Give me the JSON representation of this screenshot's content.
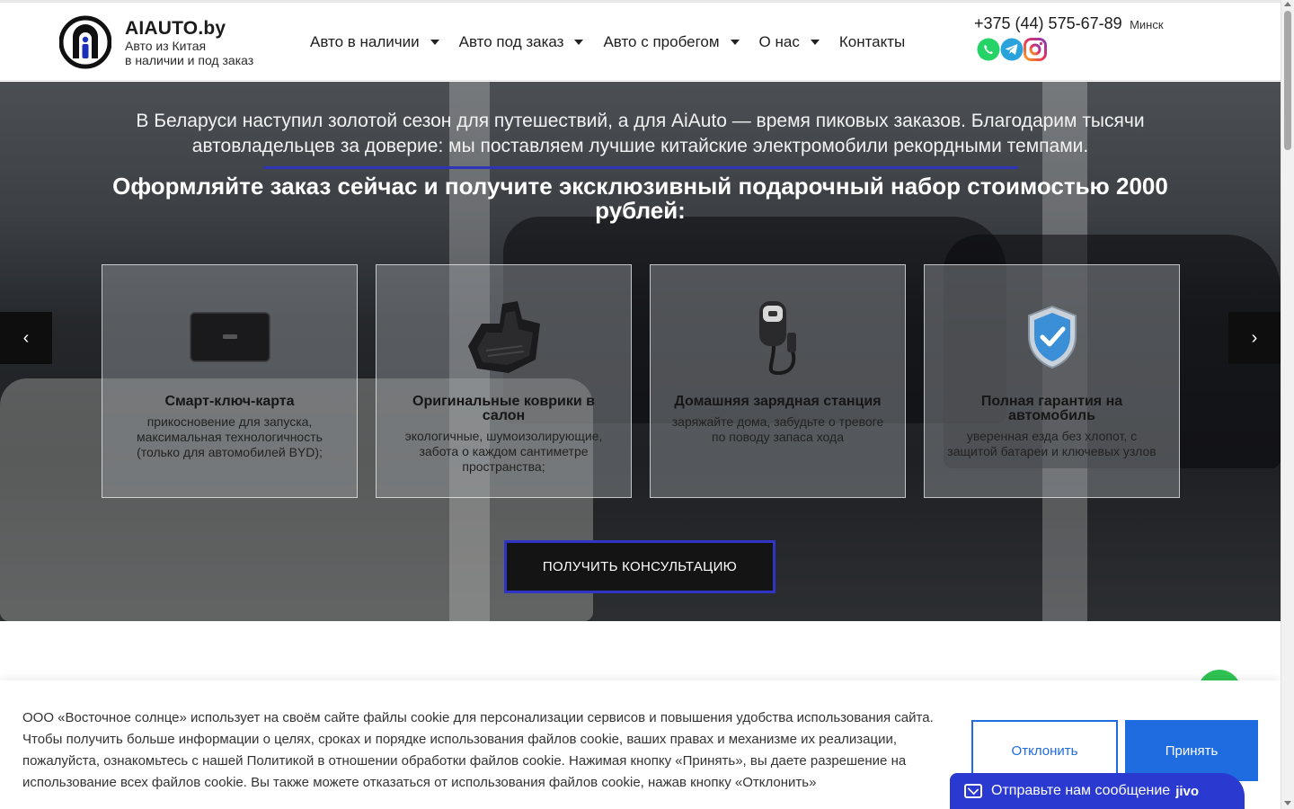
{
  "header": {
    "brand_name": "AIAUTO.by",
    "brand_line1": "Авто из Китая",
    "brand_line2": "в наличии и под заказ",
    "nav": [
      {
        "label": "Авто в наличии",
        "dropdown": true
      },
      {
        "label": "Авто под заказ",
        "dropdown": true
      },
      {
        "label": "Авто с пробегом",
        "dropdown": true
      },
      {
        "label": "О нас",
        "dropdown": true
      },
      {
        "label": "Контакты",
        "dropdown": false
      }
    ],
    "phone": "+375 (44) 575-67-89",
    "city": "Минск",
    "socials": [
      "whatsapp-icon",
      "telegram-icon",
      "instagram-icon"
    ]
  },
  "hero": {
    "text": "В Беларуси наступил золотой сезон для путешествий, а для AiAuto — время пиковых заказов. Благодарим тысячи автовладельцев за доверие: мы поставляем лучшие китайские электромобили рекордными темпами.",
    "heading": "Оформляйте заказ сейчас и получите эксклюзивный подарочный набор стоимостью 2000 рублей:",
    "cards": [
      {
        "icon": "smart-key-card-icon",
        "title": "Смарт-ключ-карта",
        "desc": "прикосновение для запуска, максимальная технологичность (только для автомобилей BYD);"
      },
      {
        "icon": "floor-mats-icon",
        "title": "Оригинальные коврики в салон",
        "desc": "экологичные, шумоизолирующие, забота о каждом сантиметре пространства;"
      },
      {
        "icon": "home-charger-icon",
        "title": "Домашняя зарядная станция",
        "desc": "заряжайте дома, забудьте о тревоге по поводу запаса хода"
      },
      {
        "icon": "shield-check-icon",
        "title": "Полная гарантия на автомобиль",
        "desc": "уверенная езда без хлопот, с защитой батареи и ключевых узлов"
      }
    ],
    "cta": "ПОЛУЧИТЬ КОНСУЛЬТАЦИЮ",
    "prev": "‹",
    "next": "›"
  },
  "cookie": {
    "text": "ООО «Восточное солнце» использует на своём сайте файлы cookie для персонализации сервисов и повышения удобства использования сайта. Чтобы получить больше информации о целях, сроках и порядке использования файлов cookie, ваших правах и механизме их реализации, пожалуйста, ознакомьтесь с нашей Политикой в отношении обработки файлов cookie. Нажимая кнопку «Принять», вы даете разрешение на использование всех файлов cookie. Вы также можете отказаться от использования файлов cookie, нажав кнопку «Отклонить»",
    "decline": "Отклонить",
    "accept": "Принять"
  },
  "chat": {
    "label": "Отправьте нам сообщение",
    "brand": "jivo"
  },
  "colors": {
    "accent": "#1f6be0",
    "cta_border": "#2e35c4",
    "jivo": "#2a3ad0",
    "whatsapp": "#25d366",
    "telegram": "#2aa3dc"
  }
}
